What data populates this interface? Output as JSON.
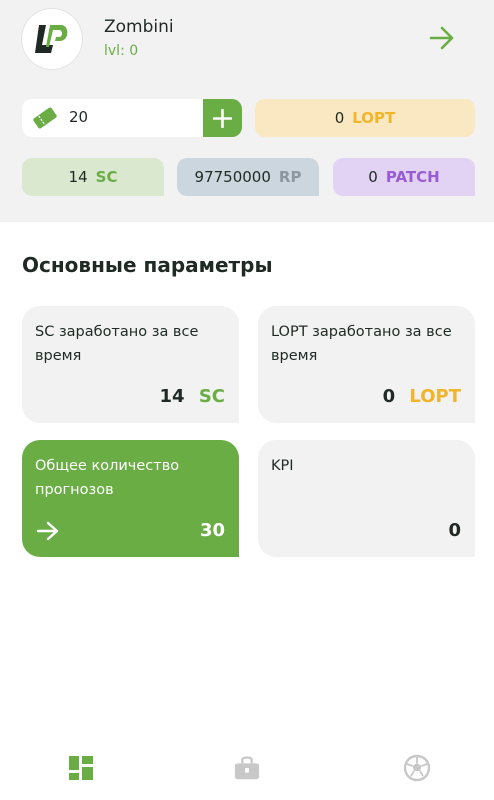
{
  "profile": {
    "username": "Zombini",
    "level": "lvl: 0"
  },
  "balances": {
    "tickets": "20",
    "lopt_value": "0",
    "lopt_currency": "LOPT",
    "sc_value": "14",
    "sc_currency": "SC",
    "rp_value": "97750000",
    "rp_currency": "RP",
    "patch_value": "0",
    "patch_currency": "PATCH"
  },
  "section": {
    "title": "Основные параметры"
  },
  "cards": [
    {
      "label": "SC заработано за все время",
      "value": "14",
      "currency": "SC"
    },
    {
      "label": "LOPT заработано за все время",
      "value": "0",
      "currency": "LOPT"
    },
    {
      "label": "Общее количество прогнозов",
      "value": "30"
    },
    {
      "label": "KPI",
      "value": "0"
    }
  ],
  "colors": {
    "accent": "#6aad45",
    "gold": "#f2b429",
    "purple": "#9a5bd6",
    "gray": "#8e969e",
    "text": "#1f2a24"
  },
  "icons": {
    "logo": "lp-logo-icon",
    "next": "arrow-right-icon",
    "ticket": "ticket-icon",
    "plus": "plus-icon",
    "nav": [
      "grid-icon",
      "bag-icon",
      "football-icon"
    ]
  }
}
